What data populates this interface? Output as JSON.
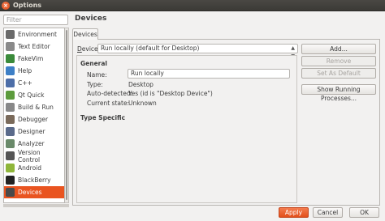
{
  "window": {
    "title": "Options"
  },
  "filter": {
    "placeholder": "Filter"
  },
  "sidebar": {
    "items": [
      {
        "label": "Environment",
        "icon": "environment-icon",
        "color": "#6a6a6a"
      },
      {
        "label": "Text Editor",
        "icon": "text-editor-icon",
        "color": "#8a8a8a"
      },
      {
        "label": "FakeVim",
        "icon": "fakevim-icon",
        "color": "#3a8a3a"
      },
      {
        "label": "Help",
        "icon": "help-icon",
        "color": "#3d7fc6"
      },
      {
        "label": "C++",
        "icon": "cpp-icon",
        "color": "#4d6ea8"
      },
      {
        "label": "Qt Quick",
        "icon": "qt-quick-icon",
        "color": "#5c9b3c"
      },
      {
        "label": "Build & Run",
        "icon": "build-run-icon",
        "color": "#888888"
      },
      {
        "label": "Debugger",
        "icon": "debugger-icon",
        "color": "#7a6a5a"
      },
      {
        "label": "Designer",
        "icon": "designer-icon",
        "color": "#5a6a8a"
      },
      {
        "label": "Analyzer",
        "icon": "analyzer-icon",
        "color": "#6a8a6a"
      },
      {
        "label": "Version Control",
        "icon": "version-control-icon",
        "color": "#555555"
      },
      {
        "label": "Android",
        "icon": "android-icon",
        "color": "#8fb63a"
      },
      {
        "label": "BlackBerry",
        "icon": "blackberry-icon",
        "color": "#222222"
      },
      {
        "label": "Devices",
        "icon": "devices-icon",
        "color": "#4a4a4a",
        "selected": true
      }
    ]
  },
  "page": {
    "title": "Devices",
    "tab": "Devices",
    "device_label_prefix": "D",
    "device_label_rest": "evice:",
    "device_value": "Run locally (default for Desktop)",
    "general_title": "General",
    "name_label": "Name:",
    "name_value": "Run locally",
    "type_label": "Type:",
    "type_value": "Desktop",
    "auto_label": "Auto-detected:",
    "auto_value": "Yes (id is \"Desktop Device\")",
    "state_label": "Current state:",
    "state_value": "Unknown",
    "type_specific": "Type Specific"
  },
  "buttons": {
    "add": "Add...",
    "remove": "Remove",
    "set_default": "Set As Default",
    "show_processes": "Show Running Processes..."
  },
  "dialog": {
    "apply": "Apply",
    "cancel": "Cancel",
    "ok": "OK"
  },
  "colors": {
    "accent": "#e95420",
    "titlebar": "#3b3a36"
  }
}
